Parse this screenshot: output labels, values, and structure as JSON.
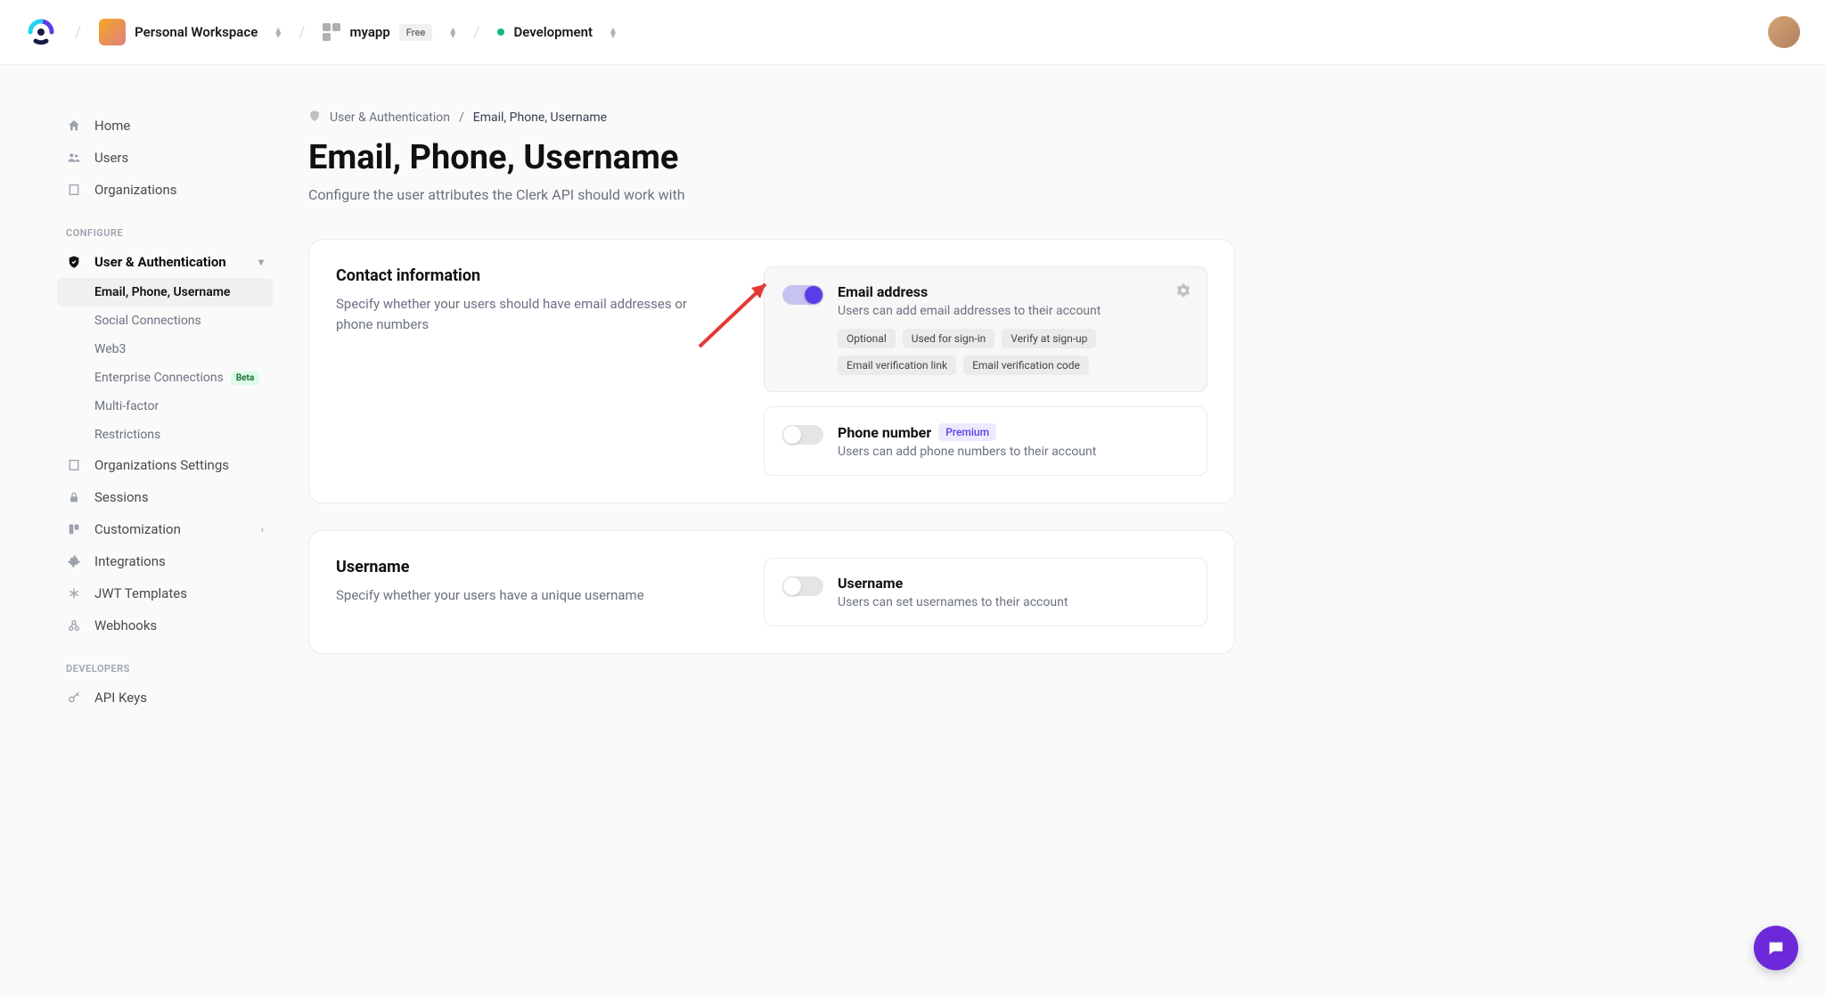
{
  "header": {
    "workspace": "Personal Workspace",
    "app": "myapp",
    "tier": "Free",
    "env": "Development"
  },
  "sidebar": {
    "primary": [
      {
        "label": "Home"
      },
      {
        "label": "Users"
      },
      {
        "label": "Organizations"
      }
    ],
    "configure_label": "CONFIGURE",
    "user_auth": "User & Authentication",
    "user_auth_sub": [
      {
        "label": "Email, Phone, Username",
        "active": true
      },
      {
        "label": "Social Connections"
      },
      {
        "label": "Web3"
      },
      {
        "label": "Enterprise Connections",
        "beta": "Beta"
      },
      {
        "label": "Multi-factor"
      },
      {
        "label": "Restrictions"
      }
    ],
    "rest": [
      {
        "label": "Organizations Settings"
      },
      {
        "label": "Sessions"
      },
      {
        "label": "Customization",
        "expand": true
      },
      {
        "label": "Integrations"
      },
      {
        "label": "JWT Templates"
      },
      {
        "label": "Webhooks"
      }
    ],
    "developers_label": "DEVELOPERS",
    "api_keys": "API Keys"
  },
  "breadcrumb": {
    "parent": "User & Authentication",
    "current": "Email, Phone, Username"
  },
  "page": {
    "title": "Email, Phone, Username",
    "subtitle": "Configure the user attributes the Clerk API should work with"
  },
  "contact_card": {
    "title": "Contact information",
    "desc": "Specify whether your users should have email addresses or phone numbers",
    "email": {
      "title": "Email address",
      "desc": "Users can add email addresses to their account",
      "tags": [
        "Optional",
        "Used for sign-in",
        "Verify at sign-up",
        "Email verification link",
        "Email verification code"
      ]
    },
    "phone": {
      "title": "Phone number",
      "badge": "Premium",
      "desc": "Users can add phone numbers to their account"
    }
  },
  "username_card": {
    "title": "Username",
    "desc": "Specify whether your users have a unique username",
    "option": {
      "title": "Username",
      "desc": "Users can set usernames to their account"
    }
  }
}
